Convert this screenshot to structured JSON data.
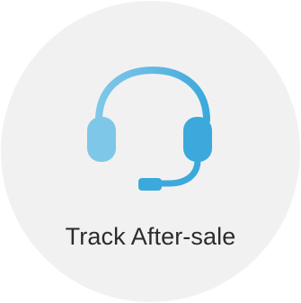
{
  "tile": {
    "label": "Track After-sale",
    "icon": "headset-icon"
  },
  "colors": {
    "circle_background": "#f1f1f1",
    "icon_light_blue": "#7ec7e8",
    "icon_blue": "#3ba9dc",
    "label_text": "#2b2b2b"
  }
}
